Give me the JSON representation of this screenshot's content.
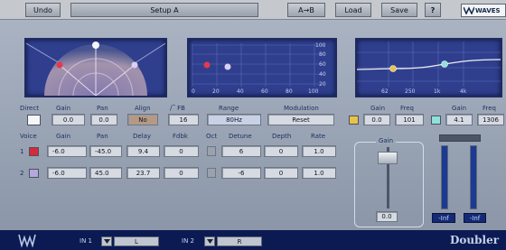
{
  "toolbar": {
    "undo": "Undo",
    "preset": "Setup A",
    "ab": "A→B",
    "load": "Load",
    "save": "Save",
    "help": "?",
    "brand": "WAVES"
  },
  "spectrum": {
    "y_ticks": [
      "100",
      "80",
      "60",
      "40",
      "20"
    ],
    "x_ticks": [
      "0",
      "20",
      "40",
      "60",
      "80",
      "100"
    ]
  },
  "eq_display": {
    "x_ticks": [
      "62",
      "250",
      "1k",
      "4k"
    ]
  },
  "direct": {
    "label": "Direct",
    "gain_label": "Gain",
    "gain": "0.0",
    "pan_label": "Pan",
    "pan": "0.0",
    "align_label": "Align",
    "align": "No",
    "fb_label": "∕‾ FB",
    "fb": "16",
    "range_label": "Range",
    "range": "80Hz",
    "mod_label": "Modulation",
    "reset": "Reset"
  },
  "eq": {
    "gain_label_1": "Gain",
    "freq_label_1": "Freq",
    "gain_1": "0.0",
    "freq_1": "101",
    "gain_label_2": "Gain",
    "freq_label_2": "Freq",
    "gain_2": "4.1",
    "freq_2": "1306"
  },
  "voice_headers": {
    "voice": "Voice",
    "gain": "Gain",
    "pan": "Pan",
    "delay": "Delay",
    "fdbk": "Fdbk",
    "oct": "Oct",
    "detune": "Detune",
    "depth": "Depth",
    "rate": "Rate"
  },
  "voices": [
    {
      "num": "1",
      "gain": "-6.0",
      "pan": "-45.0",
      "delay": "9.4",
      "fdbk": "0",
      "detune": "6",
      "depth": "0",
      "rate": "1.0"
    },
    {
      "num": "2",
      "gain": "-6.0",
      "pan": "45.0",
      "delay": "23.7",
      "fdbk": "0",
      "detune": "-6",
      "depth": "0",
      "rate": "1.0"
    }
  ],
  "output": {
    "gain_label": "Gain",
    "gain_value": "0.0",
    "meter_left": "-Inf",
    "meter_right": "-Inf"
  },
  "bottom": {
    "in1_label": "IN 1",
    "in1_value": "L",
    "in2_label": "IN 2",
    "in2_value": "R",
    "product": "Doubler"
  },
  "colors": {
    "voice1": "#d8283a",
    "voice2": "#b4a8dc",
    "direct": "#f4f6f8",
    "eq1": "#e8c24a",
    "eq2": "#8fe0d8"
  }
}
